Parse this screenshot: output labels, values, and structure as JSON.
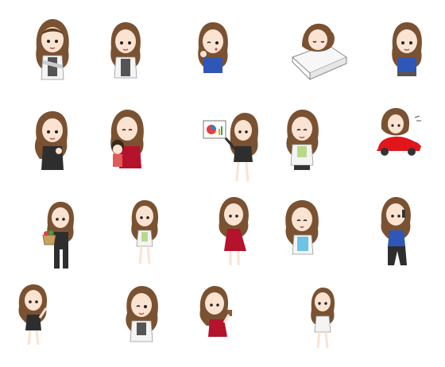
{
  "colors": {
    "background": "#ffffff",
    "hair": "#7a5232",
    "hair_dark": "#5a3a22",
    "skin": "#fbe3d2",
    "shirt_white": "#f4f4f4",
    "suit_black": "#2e2e2e",
    "top_blue": "#2f57b8",
    "top_green": "#b9d98a",
    "top_cyan": "#6cc3e6",
    "dress_red": "#b5122c",
    "car_red": "#e0161b"
  },
  "stickers": [
    {
      "id": "sticker-1",
      "pose": "standing-arms-crossed",
      "top": "white",
      "prop": "none"
    },
    {
      "id": "sticker-2",
      "pose": "standing-neutral",
      "top": "white",
      "prop": "none"
    },
    {
      "id": "sticker-3",
      "pose": "wink-thinking",
      "top": "blue",
      "prop": "none"
    },
    {
      "id": "sticker-4",
      "pose": "sleeping",
      "top": "none",
      "prop": "pillow-icon"
    },
    {
      "id": "sticker-5",
      "pose": "standing-neutral",
      "top": "blue",
      "prop": "none"
    },
    {
      "id": "sticker-6",
      "pose": "suit-hands-up",
      "top": "black",
      "prop": "none"
    },
    {
      "id": "sticker-7",
      "pose": "hugging-child",
      "top": "red",
      "prop": "child"
    },
    {
      "id": "sticker-8",
      "pose": "presenting",
      "top": "black",
      "prop": "chart-board-icon"
    },
    {
      "id": "sticker-9",
      "pose": "smiling",
      "top": "green",
      "prop": "none"
    },
    {
      "id": "sticker-10",
      "pose": "driving",
      "top": "none",
      "prop": "red-car-icon"
    },
    {
      "id": "sticker-11",
      "pose": "holding-basket",
      "top": "black",
      "prop": "vegetable-basket-icon"
    },
    {
      "id": "sticker-12",
      "pose": "standing-small",
      "top": "white",
      "prop": "none"
    },
    {
      "id": "sticker-13",
      "pose": "red-dress",
      "top": "red",
      "prop": "none"
    },
    {
      "id": "sticker-14",
      "pose": "laughing",
      "top": "cyan",
      "prop": "none"
    },
    {
      "id": "sticker-15",
      "pose": "phone-call",
      "top": "blue",
      "prop": "phone-icon"
    },
    {
      "id": "sticker-16",
      "pose": "waving",
      "top": "black",
      "prop": "none"
    },
    {
      "id": "sticker-17",
      "pose": "wink",
      "top": "white",
      "prop": "none"
    },
    {
      "id": "sticker-18",
      "pose": "drinking",
      "top": "red",
      "prop": "cup-icon"
    },
    {
      "id": "sticker-19",
      "pose": "standing-small",
      "top": "white",
      "prop": "none"
    }
  ]
}
